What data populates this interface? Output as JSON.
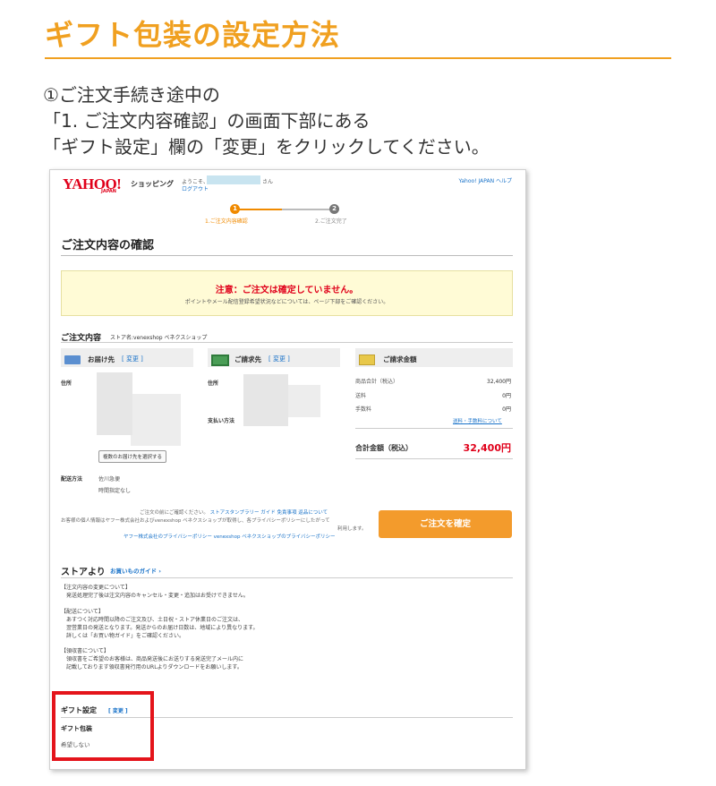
{
  "guide": {
    "title": "ギフト包装の設定方法",
    "instruction_lines": [
      "①ご注文手続き途中の",
      "「1. ご注文内容確認」の画面下部にある",
      "「ギフト設定」欄の「変更」をクリックしてください。"
    ]
  },
  "screenshot": {
    "header": {
      "logo_text": "YAHOO!",
      "logo_sub": "JAPAN",
      "service": "ショッピング",
      "welcome_prefix": "ようこそ、",
      "welcome_suffix": "さん",
      "logout": "ログアウト",
      "links": "Yahoo! JAPAN  ヘルプ"
    },
    "steps": [
      {
        "number": "1",
        "label": "1.ご注文内容確認",
        "active": true
      },
      {
        "number": "2",
        "label": "2.ご注文完了",
        "active": false
      }
    ],
    "page_heading": "ご注文内容の確認",
    "notice": {
      "main": "注意：ご注文は確定していません。",
      "sub": "ポイントやメール配信登録希望状況などについては、ページ下部をご確認ください。"
    },
    "order": {
      "heading": "ご注文内容",
      "store": "ストア名:venexshop ベネクスショップ"
    },
    "delivery": {
      "title": "お届け先",
      "change": "[ 変更 ]",
      "address_label": "住所",
      "multi_address_button": "複数のお届け先を選択する",
      "method_label": "配送方法",
      "method_value": "佐川急便",
      "time_value": "時間指定なし"
    },
    "billing": {
      "title": "ご請求先",
      "change": "[ 変更 ]",
      "address_label": "住所",
      "payment_label": "支払い方法"
    },
    "amount": {
      "title": "ご請求金額",
      "rows": [
        {
          "label": "商品合計（税込）",
          "value": "32,400円"
        },
        {
          "label": "送料",
          "value": "0円"
        },
        {
          "label": "手数料",
          "value": "0円"
        }
      ],
      "fee_link": "送料・手数料について",
      "total_label": "合計金額（税込）",
      "total_value": "32,400円"
    },
    "privacy": {
      "line1_text": "ご注文の前にご確認ください。",
      "line1_links": "ストアスタンプラリー ガイド  免責事項  返品について",
      "line2": "お客様の個人情報はヤフー株式会社およびvenexshop ベネクスショップが取得し、各プライバシーポリシーにしたがって",
      "line3": "利用します。",
      "line4_links": "ヤフー株式会社のプライバシーポリシー   venexshop ベネクスショップのプライバシーポリシー"
    },
    "confirm_button": "ご注文を確定",
    "store_section": {
      "heading": "ストアより",
      "guide_link": "お買いものガイド ›",
      "notes": [
        [
          "【注文内容の変更について】",
          "発送処理完了後は注文内容のキャンセル・変更・追加はお受けできません。"
        ],
        [
          "【配送について】",
          "あすつく対応時間以降のご注文及び、土日祝・ストア休業日のご注文は、",
          "翌営業日の発送となります。発送からのお届け日数は、地域により異なります。",
          "詳しくは「お買い物ガイド」をご確認ください。"
        ],
        [
          "【領収書について】",
          "領収書をご希望のお客様は、商品発送後にお送りする発送完了メール内に",
          "記載しております領収書発行用のURLよりダウンロードをお願いします。"
        ]
      ]
    },
    "gift": {
      "heading": "ギフト設定",
      "change": "[ 変更 ]",
      "wrap_label": "ギフト包装",
      "wrap_value": "希望しない"
    }
  },
  "colors": {
    "accent": "#f0a020",
    "yahoo_red": "#e0001a",
    "confirm_button": "#f39b2c",
    "highlight": "#e4141b",
    "link": "#1a73c9"
  }
}
